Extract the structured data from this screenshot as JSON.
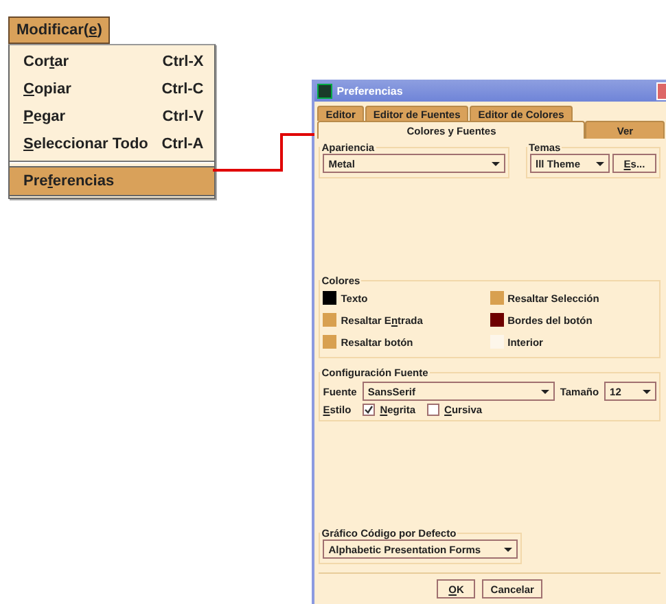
{
  "menu": {
    "title": [
      {
        "text": "Modificar(",
        "underlined": false
      },
      {
        "text": "e",
        "underlined": true
      },
      {
        "text": ")",
        "underlined": false
      }
    ],
    "items": [
      {
        "kind": "item",
        "label": [
          {
            "text": "Cor",
            "underlined": false
          },
          {
            "text": "t",
            "underlined": true
          },
          {
            "text": "ar",
            "underlined": false
          }
        ],
        "shortcut": "Ctrl-X",
        "selected": false
      },
      {
        "kind": "item",
        "label": [
          {
            "text": "C",
            "underlined": true
          },
          {
            "text": "opiar",
            "underlined": false
          }
        ],
        "shortcut": "Ctrl-C",
        "selected": false
      },
      {
        "kind": "item",
        "label": [
          {
            "text": "P",
            "underlined": true
          },
          {
            "text": "egar",
            "underlined": false
          }
        ],
        "shortcut": "Ctrl-V",
        "selected": false
      },
      {
        "kind": "item",
        "label": [
          {
            "text": "S",
            "underlined": true
          },
          {
            "text": "eleccionar Todo",
            "underlined": false
          }
        ],
        "shortcut": "Ctrl-A",
        "selected": false
      },
      {
        "kind": "separator"
      },
      {
        "kind": "item",
        "label": [
          {
            "text": "Pre",
            "underlined": false
          },
          {
            "text": "f",
            "underlined": true
          },
          {
            "text": "erencias",
            "underlined": false
          }
        ],
        "selected": true
      }
    ]
  },
  "dialog": {
    "title": "Preferencias",
    "tabs_row_1": [
      {
        "label": "Editor",
        "selected": false
      },
      {
        "label": "Editor de Fuentes",
        "selected": false
      },
      {
        "label": "Editor de Colores",
        "selected": false
      }
    ],
    "tabs_row_2": [
      {
        "label": "Colores y Fuentes",
        "selected": true
      },
      {
        "label": "Ver",
        "selected": false
      }
    ],
    "apariencia": {
      "title": "Apariencia",
      "value": "Metal"
    },
    "temas": {
      "title": "Temas",
      "value": "lll Theme",
      "button": [
        {
          "text": "E",
          "underlined": true
        },
        {
          "text": "s...",
          "underlined": false
        }
      ]
    },
    "colores": {
      "title": "Colores",
      "items": [
        {
          "label": [
            {
              "text": "Texto",
              "underlined": false
            }
          ],
          "color": "#000000"
        },
        {
          "label": [
            {
              "text": "Resaltar Selección",
              "underlined": false
            }
          ],
          "color": "#d8a050"
        },
        {
          "label": [
            {
              "text": "Resaltar E",
              "underlined": false
            },
            {
              "text": "n",
              "underlined": true
            },
            {
              "text": "trada",
              "underlined": false
            }
          ],
          "color": "#d8a050"
        },
        {
          "label": [
            {
              "text": "Bordes del botón",
              "underlined": false
            }
          ],
          "color": "#6e0000"
        },
        {
          "label": [
            {
              "text": "Resaltar botón",
              "underlined": false
            }
          ],
          "color": "#d8a050"
        },
        {
          "label": [
            {
              "text": "Interior",
              "underlined": false
            }
          ],
          "color": "#fdf6ea"
        }
      ]
    },
    "fuente": {
      "title": "Configuración Fuente",
      "font_label": "Fuente",
      "font_value": "SansSerif",
      "size_label": "Tamaño",
      "size_value": "12",
      "style_label": [
        {
          "text": "E",
          "underlined": true
        },
        {
          "text": "stilo",
          "underlined": false
        }
      ],
      "styles": [
        {
          "label": [
            {
              "text": "N",
              "underlined": true
            },
            {
              "text": "egrita",
              "underlined": false
            }
          ],
          "checked": true
        },
        {
          "label": [
            {
              "text": "C",
              "underlined": true
            },
            {
              "text": "ursiva",
              "underlined": false
            }
          ],
          "checked": false
        }
      ]
    },
    "grafico": {
      "title": "Gráfico Código por Defecto",
      "value": "Alphabetic Presentation Forms"
    },
    "buttons": [
      [
        {
          "text": "O",
          "underlined": true
        },
        {
          "text": "K",
          "underlined": false
        }
      ],
      [
        {
          "text": "Cancelar",
          "underlined": false
        }
      ]
    ]
  }
}
